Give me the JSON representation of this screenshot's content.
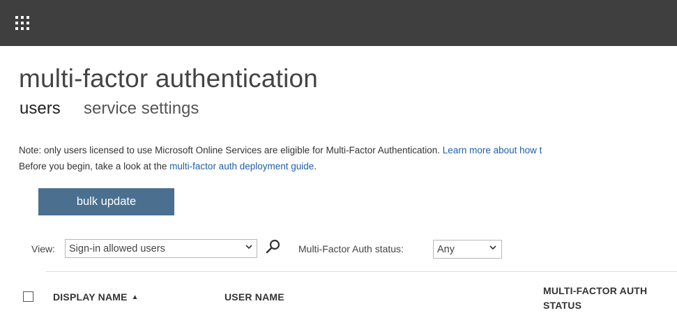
{
  "header": {
    "app_launcher_icon": "waffle-grid-icon"
  },
  "page": {
    "title": "multi-factor authentication",
    "tabs": [
      {
        "label": "users",
        "active": true
      },
      {
        "label": "service settings",
        "active": false
      }
    ]
  },
  "note": {
    "line1_text": "Note: only users licensed to use Microsoft Online Services are eligible for Multi-Factor Authentication.",
    "line1_link": "Learn more about how t",
    "line2_text": "Before you begin, take a look at the",
    "line2_link": "multi-factor auth deployment guide",
    "line2_end": "."
  },
  "actions": {
    "bulk_update_label": "bulk update"
  },
  "filters": {
    "view_label": "View:",
    "view_value": "Sign-in allowed users",
    "search_icon": "search-icon",
    "status_label": "Multi-Factor Auth status:",
    "status_value": "Any"
  },
  "table": {
    "columns": [
      {
        "label": "DISPLAY NAME",
        "sort": "ascending"
      },
      {
        "label": "USER NAME"
      },
      {
        "label": "MULTI-FACTOR AUTH STATUS"
      }
    ]
  },
  "colors": {
    "topbar": "#3f3f3f",
    "button": "#4a6f8f",
    "link": "#1f5fa8"
  }
}
